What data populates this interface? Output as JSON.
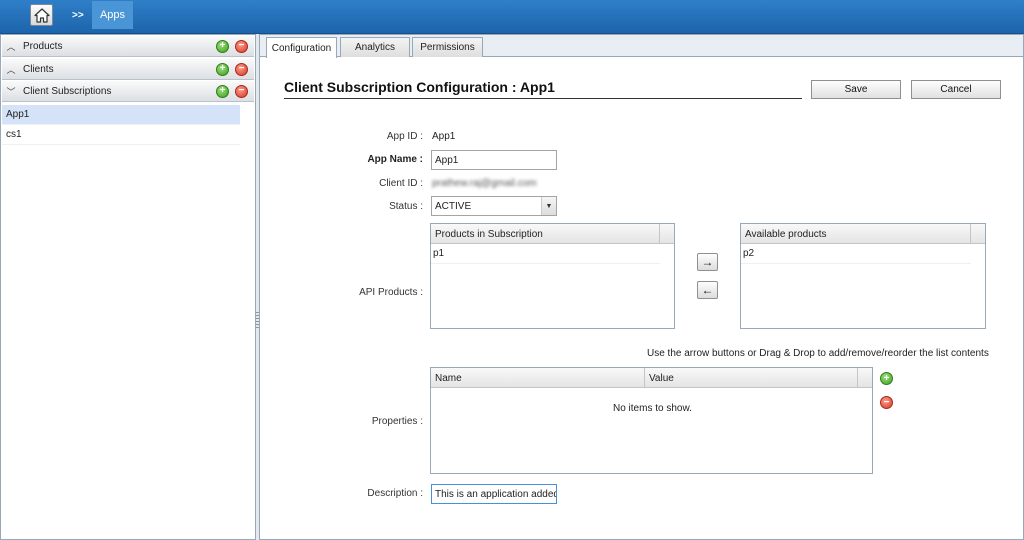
{
  "topbar": {
    "home_icon": "home-icon",
    "separator": ">>",
    "breadcrumb_current": "Apps"
  },
  "sidebar": {
    "sections": [
      {
        "label": "Products",
        "expanded": false
      },
      {
        "label": "Clients",
        "expanded": false
      },
      {
        "label": "Client Subscriptions",
        "expanded": true
      }
    ],
    "items": [
      {
        "label": "App1",
        "selected": true
      },
      {
        "label": "cs1",
        "selected": false
      }
    ]
  },
  "tabs": [
    {
      "label": "Configuration",
      "active": true
    },
    {
      "label": "Analytics",
      "active": false
    },
    {
      "label": "Permissions",
      "active": false
    }
  ],
  "form": {
    "title": "Client Subscription Configuration : App1",
    "save_label": "Save",
    "cancel_label": "Cancel",
    "app_id_label": "App ID :",
    "app_id_value": "App1",
    "app_name_label": "App Name :",
    "app_name_value": "App1",
    "client_id_label": "Client ID :",
    "client_id_value": "prathew.raj@gmail.com",
    "status_label": "Status :",
    "status_value": "ACTIVE",
    "api_products_label": "API Products :",
    "subscribed_header": "Products in Subscription",
    "subscribed_items": [
      "p1"
    ],
    "available_header": "Available products",
    "available_items": [
      "p2"
    ],
    "move_right_label": "→",
    "move_left_label": "←",
    "hint": "Use the arrow buttons or Drag & Drop to add/remove/reorder the list contents",
    "properties_label": "Properties :",
    "properties_columns": [
      "Name",
      "Value"
    ],
    "properties_empty": "No items to show.",
    "description_label": "Description :",
    "description_value": "This is an application added"
  },
  "colors": {
    "topbar": "#1d64ab",
    "selected_row": "#d4e3f7",
    "add_icon": "#3c9d22",
    "remove_icon": "#d23a26"
  }
}
